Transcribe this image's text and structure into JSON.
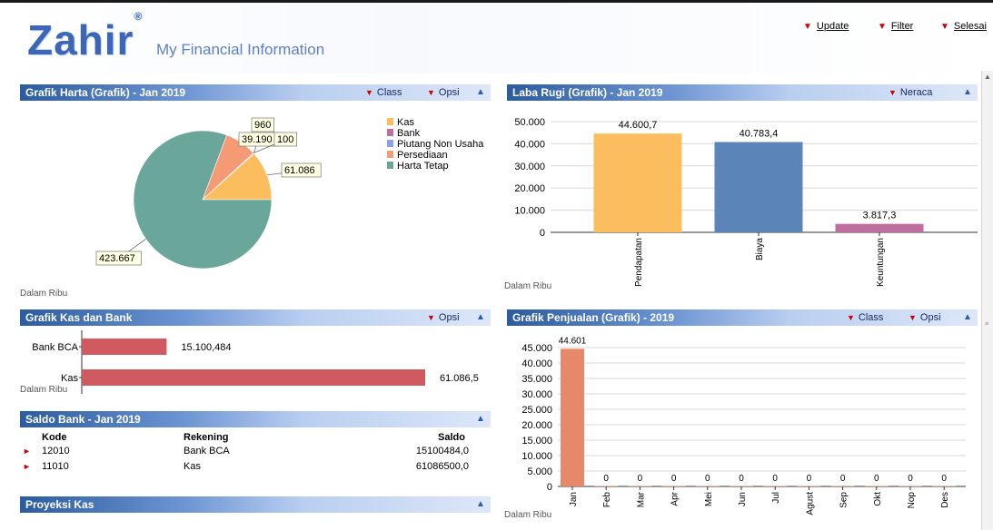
{
  "app": {
    "logo": "Zahir",
    "logo_mark": "®",
    "subtitle": "My Financial Information"
  },
  "toolbar": {
    "update": "Update",
    "filter": "Filter",
    "selesai": "Selesai"
  },
  "colors": {
    "kas": "#fbbd5e",
    "bank": "#c06da0",
    "piutang": "#8f9ee8",
    "persediaan": "#f49a75",
    "harta_tetap": "#6aa79a",
    "pendapatan": "#fbbd5e",
    "biaya": "#5b84b9",
    "keuntungan": "#c06da0",
    "kas_bar": "#d05a62",
    "penjualan": "#e7886a"
  },
  "harta": {
    "title": "Grafik Harta (Grafik) - Jan 2019",
    "btn_class": "Class",
    "btn_opsi": "Opsi",
    "note": "Dalam Ribu",
    "legend": [
      "Kas",
      "Bank",
      "Piutang Non Usaha",
      "Persediaan",
      "Harta Tetap"
    ],
    "labels": {
      "kas": "61.086",
      "bank": "960",
      "persediaan": "39.190",
      "piutang": "100",
      "harta_tetap": "423.667"
    },
    "chart_data": {
      "type": "pie",
      "categories": [
        "Kas",
        "Bank",
        "Piutang Non Usaha",
        "Persediaan",
        "Harta Tetap"
      ],
      "values": [
        61086,
        960,
        100,
        39190,
        423667
      ]
    }
  },
  "laba": {
    "title": "Laba Rugi (Grafik) - Jan 2019",
    "btn_neraca": "Neraca",
    "note": "Dalam Ribu",
    "chart_data": {
      "type": "bar",
      "categories": [
        "Pendapatan",
        "Biaya",
        "Keuntungan"
      ],
      "values": [
        44600.7,
        40783.4,
        3817.3
      ],
      "value_labels": [
        "44.600,7",
        "40.783,4",
        "3.817,3"
      ],
      "yticks": [
        "50.000",
        "40.000",
        "30.000",
        "20.000",
        "10.000",
        "0"
      ],
      "ylim": [
        0,
        50000
      ]
    }
  },
  "kasbank": {
    "title": "Grafik Kas dan Bank",
    "btn_opsi": "Opsi",
    "note": "Dalam Ribu",
    "chart_data": {
      "type": "bar",
      "orientation": "horizontal",
      "categories": [
        "Bank BCA",
        "Kas"
      ],
      "values": [
        15100.484,
        61086.5
      ],
      "value_labels": [
        "15.100,484",
        "61.086,5"
      ]
    }
  },
  "saldo": {
    "title": "Saldo Bank - Jan 2019",
    "headers": {
      "kode": "Kode",
      "rekening": "Rekening",
      "saldo": "Saldo"
    },
    "rows": [
      {
        "kode": "12010",
        "rekening": "Bank BCA",
        "saldo": "15100484,0"
      },
      {
        "kode": "11010",
        "rekening": "Kas",
        "saldo": "61086500,0"
      }
    ]
  },
  "proyeksi": {
    "title": "Proyeksi Kas"
  },
  "penjualan": {
    "title": "Grafik Penjualan (Grafik) - 2019",
    "btn_class": "Class",
    "btn_opsi": "Opsi",
    "note": "Dalam Ribu",
    "chart_data": {
      "type": "bar",
      "categories": [
        "Jan",
        "Feb",
        "Mar",
        "Apr",
        "Mei",
        "Jun",
        "Jul",
        "Agust",
        "Sep",
        "Okt",
        "Nop",
        "Des"
      ],
      "values": [
        44601,
        0,
        0,
        0,
        0,
        0,
        0,
        0,
        0,
        0,
        0,
        0
      ],
      "value_labels": [
        "44.601",
        "0",
        "0",
        "0",
        "0",
        "0",
        "0",
        "0",
        "0",
        "0",
        "0",
        "0"
      ],
      "yticks": [
        "45.000",
        "40.000",
        "35.000",
        "30.000",
        "25.000",
        "20.000",
        "15.000",
        "10.000",
        "5.000",
        "0"
      ],
      "ylim": [
        0,
        45000
      ]
    }
  }
}
